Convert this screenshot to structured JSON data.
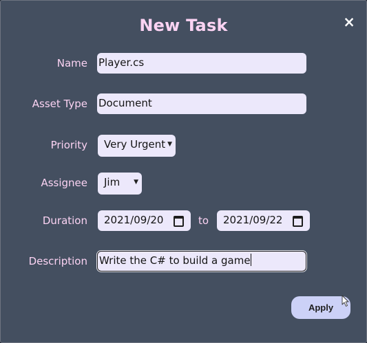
{
  "dialog": {
    "title": "New Task",
    "close_label": "×"
  },
  "form": {
    "name": {
      "label": "Name",
      "value": "Player.cs"
    },
    "asset_type": {
      "label": "Asset Type",
      "value": "Document"
    },
    "priority": {
      "label": "Priority",
      "value": "Very Urgent"
    },
    "assignee": {
      "label": "Assignee",
      "value": "Jim"
    },
    "duration": {
      "label": "Duration",
      "start": "2021/09/20",
      "separator": "to",
      "end": "2021/09/22"
    },
    "description": {
      "label": "Description",
      "value": "Write the C# to build a game"
    }
  },
  "actions": {
    "apply_label": "Apply"
  },
  "icons": {
    "select_caret": "chevron-down-icon",
    "date_picker": "calendar-icon",
    "close": "close-icon",
    "mouse": "mouse-cursor-icon"
  }
}
